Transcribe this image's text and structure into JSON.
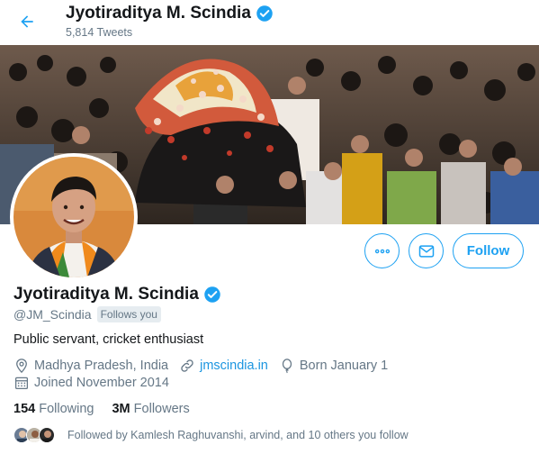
{
  "header": {
    "name": "Jyotiraditya M. Scindia",
    "tweet_count": "5,814 Tweets"
  },
  "colors": {
    "accent": "#1da1f2",
    "link": "#1b95e0",
    "muted": "#657786",
    "text": "#14171a"
  },
  "profile": {
    "name": "Jyotiraditya M. Scindia",
    "handle": "@JM_Scindia",
    "follows_you": "Follows you",
    "bio": "Public servant, cricket enthusiast",
    "location": "Madhya Pradesh, India",
    "website": "jmscindia.in",
    "birthday": "Born January 1",
    "joined": "Joined November 2014"
  },
  "actions": {
    "follow_label": "Follow"
  },
  "counts": {
    "following_num": "154",
    "following_label": "Following",
    "followers_num": "3M",
    "followers_label": "Followers"
  },
  "followed_by": "Followed by Kamlesh Raghuvanshi, arvind, and 10 others you follow"
}
